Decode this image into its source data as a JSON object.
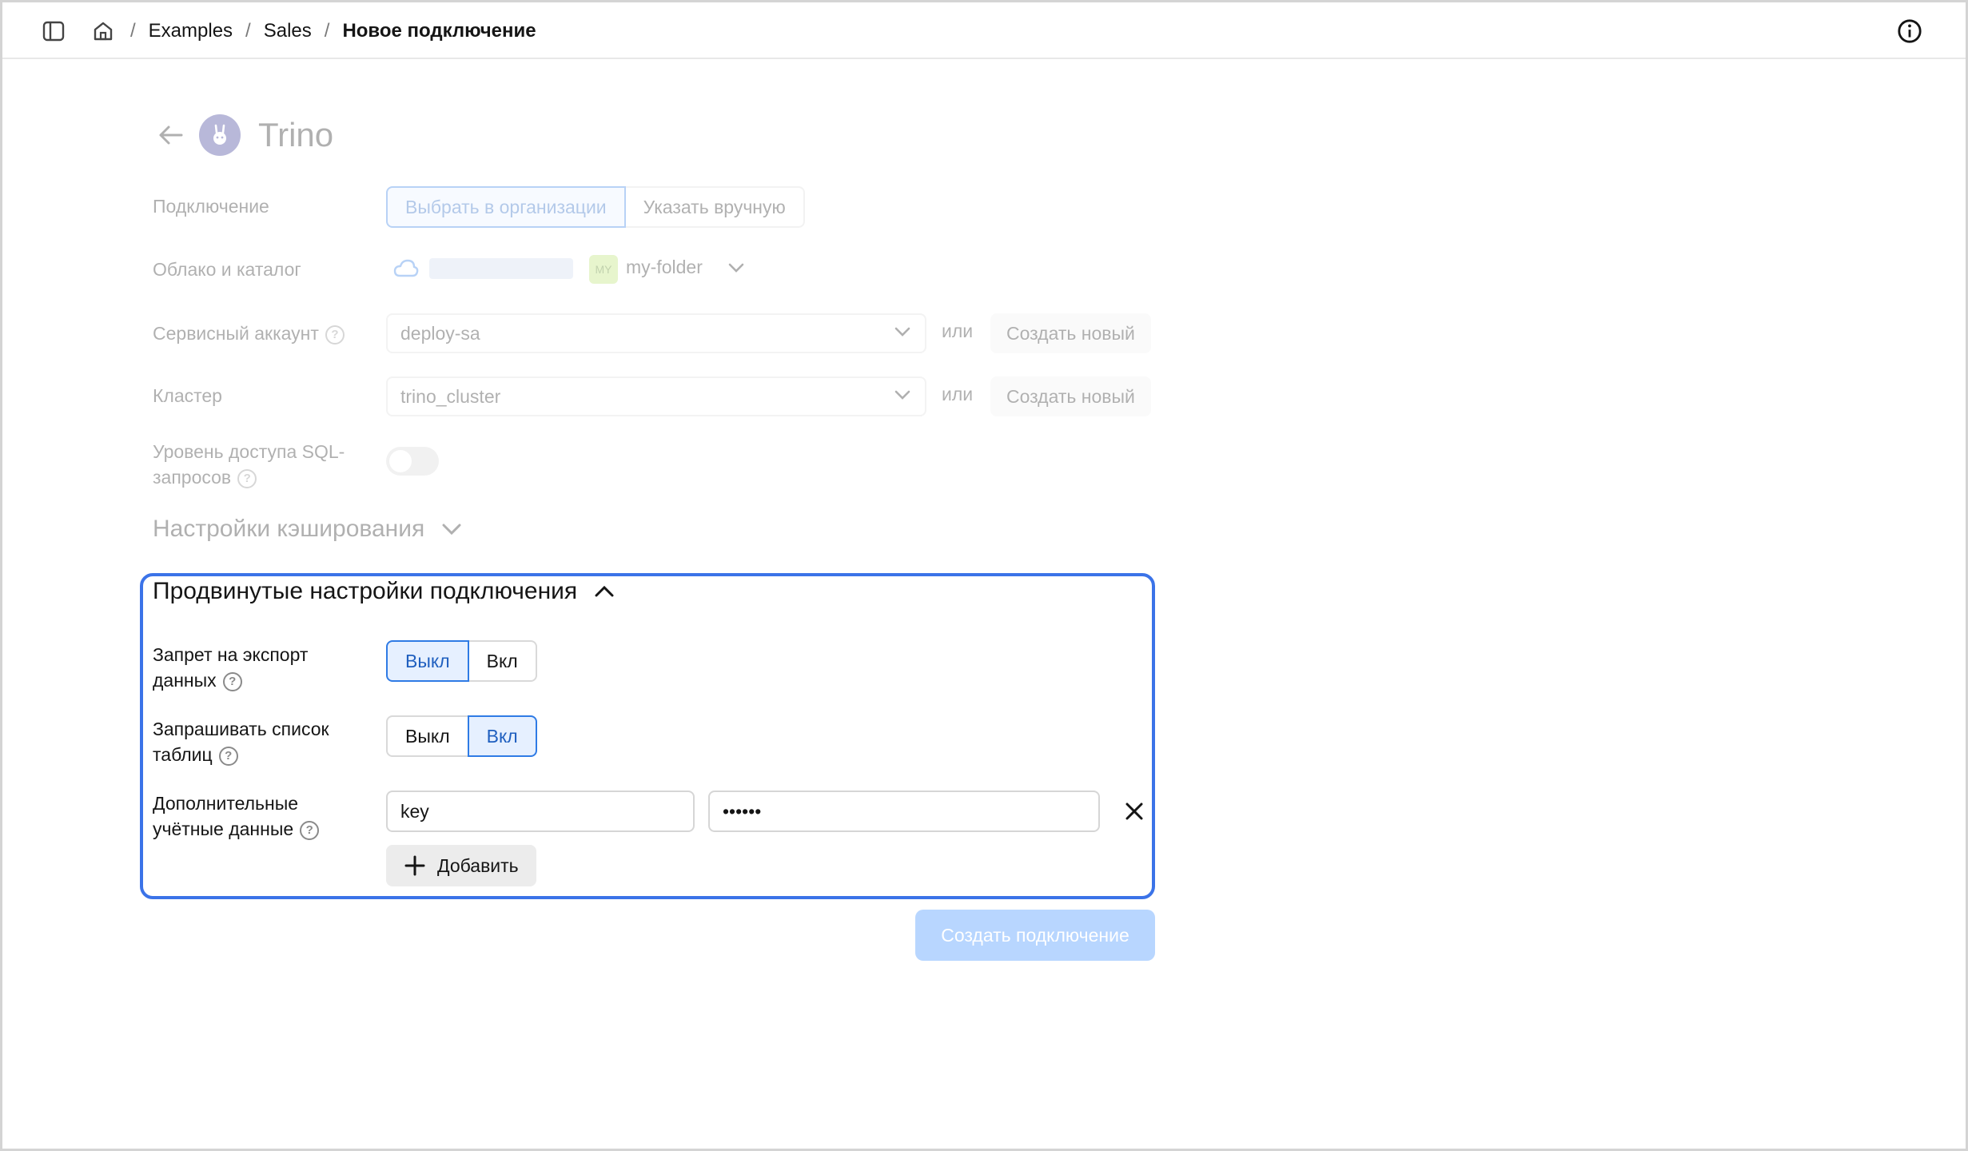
{
  "header": {
    "breadcrumbs": [
      "Examples",
      "Sales"
    ],
    "current": "Новое подключение"
  },
  "page": {
    "title": "Trino"
  },
  "connection": {
    "label": "Подключение",
    "options": [
      "Выбрать в организации",
      "Указать вручную"
    ],
    "active_index": 0
  },
  "cloud": {
    "label": "Облако и каталог",
    "folder_badge": "MY",
    "folder_name": "my-folder"
  },
  "service_account": {
    "label": "Сервисный аккаунт",
    "value": "deploy-sa",
    "or": "или",
    "create": "Создать новый"
  },
  "cluster": {
    "label": "Кластер",
    "value": "trino_cluster",
    "or": "или",
    "create": "Создать новый"
  },
  "sql_access": {
    "label_line1": "Уровень доступа SQL-",
    "label_line2": "запросов",
    "enabled": false
  },
  "cache_settings": {
    "title": "Настройки кэширования"
  },
  "advanced": {
    "title": "Продвинутые настройки подключения",
    "export_ban": {
      "label_line1": "Запрет на экспорт",
      "label_line2": "данных",
      "options": [
        "Выкл",
        "Вкл"
      ],
      "active_index": 0
    },
    "list_tables": {
      "label_line1": "Запрашивать список",
      "label_line2": "таблиц",
      "options": [
        "Выкл",
        "Вкл"
      ],
      "active_index": 1
    },
    "extra_credentials": {
      "label_line1": "Дополнительные",
      "label_line2": "учётные данные",
      "key_value": "key",
      "secret_value": "••••••",
      "add_label": "Добавить"
    }
  },
  "submit": {
    "label": "Создать подключение"
  },
  "colors": {
    "accent": "#3b73e8",
    "segment_active_bg": "#e6f0ff",
    "primary_disabled": "#b8d6ff"
  }
}
